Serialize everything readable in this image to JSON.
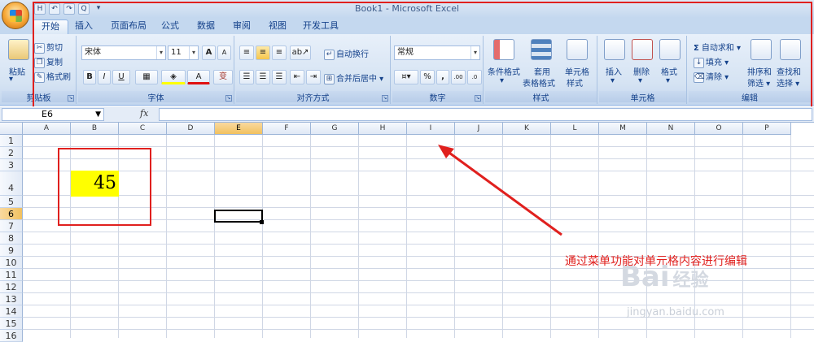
{
  "window": {
    "title": "Book1 - Microsoft Excel"
  },
  "qat": {
    "save": "H",
    "undo": "↶",
    "redo": "↷",
    "preview": "Q",
    "more": "▾"
  },
  "tabs": [
    {
      "label": "开始",
      "active": true
    },
    {
      "label": "插入"
    },
    {
      "label": "页面布局"
    },
    {
      "label": "公式"
    },
    {
      "label": "数据"
    },
    {
      "label": "审阅"
    },
    {
      "label": "视图"
    },
    {
      "label": "开发工具"
    }
  ],
  "ribbon": {
    "clipboard": {
      "label": "剪贴板",
      "paste": "粘贴",
      "cut": "剪切",
      "copy": "复制",
      "format_painter": "格式刷"
    },
    "font": {
      "label": "字体",
      "name": "宋体",
      "size": "11",
      "bold": "B",
      "italic": "I",
      "underline": "U",
      "grow": "A",
      "shrink": "A",
      "font_color": "A",
      "phonetic": "变"
    },
    "alignment": {
      "label": "对齐方式",
      "wrap": "自动换行",
      "merge": "合并后居中"
    },
    "number": {
      "label": "数字",
      "format": "常规",
      "percent": "%",
      "comma": ",",
      "inc_decimal": ".00",
      "dec_decimal": ".0"
    },
    "styles": {
      "label": "样式",
      "conditional": "条件格式",
      "table_1": "套用",
      "table_2": "表格格式",
      "cell_style_1": "单元格",
      "cell_style_2": "样式"
    },
    "cells": {
      "label": "单元格",
      "insert": "插入",
      "delete": "删除",
      "format": "格式"
    },
    "editing": {
      "label": "编辑",
      "autosum": "自动求和",
      "fill": "填充",
      "clear": "清除",
      "sort_1": "排序和",
      "sort_2": "筛选",
      "find_1": "查找和",
      "find_2": "选择"
    }
  },
  "formula_bar": {
    "cell_ref": "E6",
    "fx": "fx",
    "value": ""
  },
  "columns": [
    "A",
    "B",
    "C",
    "D",
    "E",
    "F",
    "G",
    "H",
    "I",
    "J",
    "K",
    "L",
    "M",
    "N",
    "O",
    "P"
  ],
  "rows": [
    "1",
    "2",
    "3",
    "4",
    "5",
    "6",
    "7",
    "8",
    "9",
    "10",
    "11",
    "12",
    "13",
    "14",
    "15",
    "16"
  ],
  "selected": {
    "column": "E",
    "row": "6"
  },
  "cells": {
    "b4_value": "45",
    "b4_fill": "#ffff00"
  },
  "annotation": {
    "text": "通过菜单功能对单元格内容进行编辑",
    "color": "#e0201e"
  },
  "watermark": {
    "brand": "Bai",
    "brand_cn": "经验",
    "url": "jingyan.baidu.com"
  }
}
